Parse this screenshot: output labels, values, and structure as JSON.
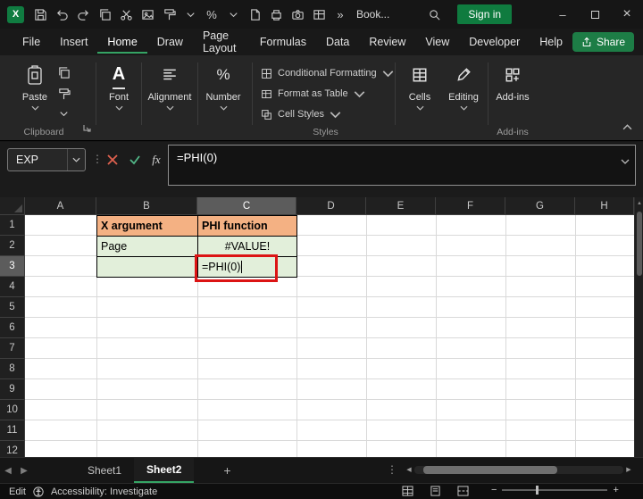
{
  "titlebar": {
    "document_title": "Book...",
    "sign_in_label": "Sign in"
  },
  "menubar": {
    "items": [
      "File",
      "Insert",
      "Home",
      "Draw",
      "Page Layout",
      "Formulas",
      "Data",
      "Review",
      "View",
      "Developer",
      "Help"
    ],
    "active_item": "Home",
    "share_label": "Share"
  },
  "ribbon": {
    "paste_label": "Paste",
    "font_label": "Font",
    "alignment_label": "Alignment",
    "number_label": "Number",
    "conditional_formatting_label": "Conditional Formatting",
    "format_as_table_label": "Format as Table",
    "cell_styles_label": "Cell Styles",
    "cells_label": "Cells",
    "editing_label": "Editing",
    "addins_label": "Add-ins",
    "group_clipboard": "Clipboard",
    "group_styles": "Styles",
    "group_addins": "Add-ins"
  },
  "formula_bar": {
    "name_box_value": "EXP",
    "fx_label": "fx",
    "formula": "=PHI(0)"
  },
  "grid": {
    "column_headers": [
      "A",
      "B",
      "C",
      "D",
      "E",
      "F",
      "G",
      "H"
    ],
    "row_headers": [
      "1",
      "2",
      "3",
      "4",
      "5",
      "6",
      "7",
      "8",
      "9",
      "10",
      "11",
      "12"
    ],
    "selected_column": "C",
    "selected_row": "3",
    "cells": {
      "B1": "X argument",
      "C1": "PHI function",
      "B2": "Page",
      "C2": "#VALUE!",
      "B3": "",
      "C3": "=PHI(0)"
    },
    "colors": {
      "header_fill": "#F4B183",
      "body_fill": "#E2EFDA",
      "annotation_red": "#DC1414"
    }
  },
  "sheetbar": {
    "tabs": [
      "Sheet1",
      "Sheet2"
    ],
    "active_tab": "Sheet2",
    "add_label": "+"
  },
  "statusbar": {
    "mode": "Edit",
    "accessibility": "Accessibility: Investigate"
  },
  "theme": {
    "accent_green": "#107C41"
  }
}
